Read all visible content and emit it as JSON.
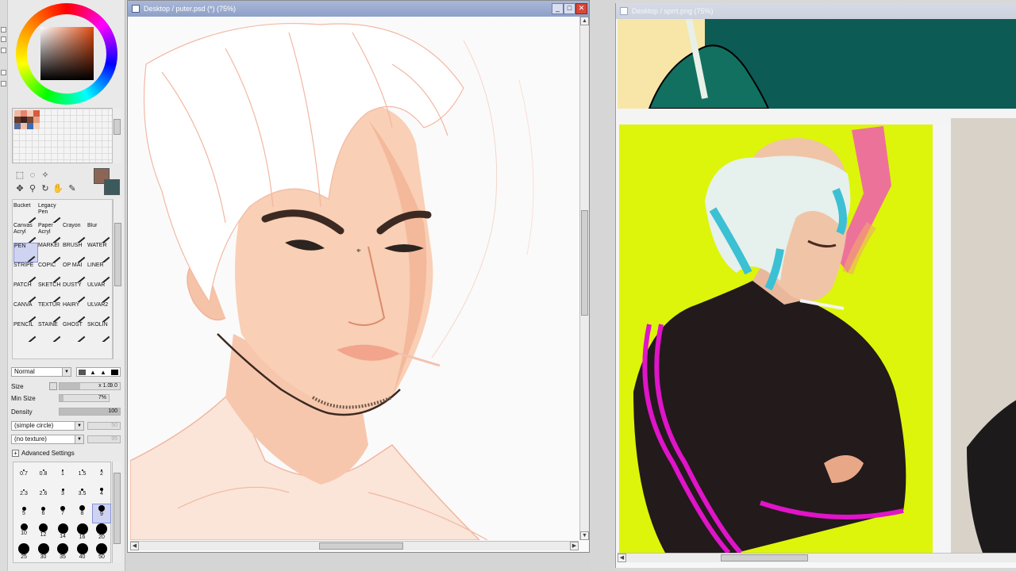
{
  "canvas_window": {
    "title": "Desktop / puter.psd (*) (75%)",
    "buttons": {
      "minimize": "_",
      "maximize": "□",
      "close": "✕"
    }
  },
  "reference_window": {
    "title": "Desktop / sprrt.png (75%)"
  },
  "tool_panel": {
    "tools": [
      {
        "label": "Bucket",
        "selected": false
      },
      {
        "label": "Legacy Pen",
        "selected": false
      },
      {
        "label": "Canvas Acryl",
        "selected": false
      },
      {
        "label": "Paper Acryl",
        "selected": false
      },
      {
        "label": "Crayon",
        "selected": false
      },
      {
        "label": "Blur",
        "selected": false
      },
      {
        "label": "PEN",
        "selected": true
      },
      {
        "label": "MARKEI",
        "selected": false
      },
      {
        "label": "BRUSH",
        "selected": false
      },
      {
        "label": "WATER",
        "selected": false
      },
      {
        "label": "STRIPE",
        "selected": false
      },
      {
        "label": "COPIC",
        "selected": false
      },
      {
        "label": "OP MAI",
        "selected": false
      },
      {
        "label": "LINER",
        "selected": false
      },
      {
        "label": "PATCH",
        "selected": false
      },
      {
        "label": "SKETCH",
        "selected": false
      },
      {
        "label": "DUSTY",
        "selected": false
      },
      {
        "label": "ULVAR",
        "selected": false
      },
      {
        "label": "CANVA",
        "selected": false
      },
      {
        "label": "TEXTUR",
        "selected": false
      },
      {
        "label": "HAIRY",
        "selected": false
      },
      {
        "label": "ULVAR2",
        "selected": false
      },
      {
        "label": "PENCIL",
        "selected": false
      },
      {
        "label": "STAINE",
        "selected": false
      },
      {
        "label": "GHOST",
        "selected": false
      },
      {
        "label": "SKOLIN",
        "selected": false
      }
    ],
    "blend_mode": "Normal",
    "size_label": "Size",
    "size_multiplier": "x 1.0",
    "size_value": "9.0",
    "min_size_label": "Min Size",
    "min_size_value": "7%",
    "density_label": "Density",
    "density_value": "100",
    "density_fraction": 1.0,
    "shape": "(simple circle)",
    "shape_value": "50",
    "texture": "(no texture)",
    "texture_value": "95",
    "advanced": "Advanced Settings",
    "brush_sizes": [
      "0.7",
      "0.8",
      "1",
      "1.5",
      "2",
      "2.3",
      "2.6",
      "3",
      "3.5",
      "4",
      "5",
      "6",
      "7",
      "8",
      "9",
      "10",
      "12",
      "14",
      "16",
      "20",
      "25",
      "30",
      "35",
      "40",
      "50"
    ],
    "selected_brush_size": "9",
    "fg_color": "#8b6656",
    "bg_color": "#3c5a5c",
    "swatches": [
      "#f0b8a0",
      "#e8846c",
      "#f4c8b4",
      "#d85a40",
      "#6a3a2c",
      "#3a2420",
      "#7c4434",
      "#e4a080",
      "#5a6c9c",
      "#f0c0a8",
      "#3c6cb4",
      "#f8d0b8"
    ]
  }
}
